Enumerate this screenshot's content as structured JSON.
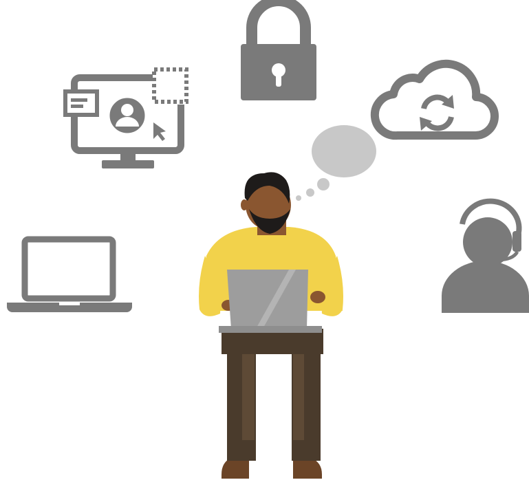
{
  "illustration": {
    "background_color": "#ffffff",
    "icon_color": "#7a7a7a",
    "thought_bubble_color": "#c8c8c8",
    "icons": [
      {
        "name": "padlock-icon"
      },
      {
        "name": "remote-desktop-icon"
      },
      {
        "name": "cloud-sync-icon"
      },
      {
        "name": "laptop-icon"
      },
      {
        "name": "customer-support-headset-icon"
      }
    ],
    "person": {
      "shirt_color": "#f2d24b",
      "skin_color": "#8a5630",
      "hair_color": "#1e1b1a",
      "pants_color": "#4a3b2c",
      "shoe_color": "#6b4427",
      "laptop_color": "#9d9d9d"
    }
  }
}
